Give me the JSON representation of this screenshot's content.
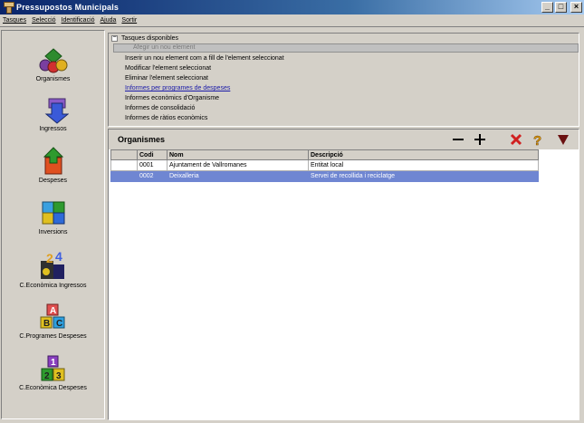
{
  "window": {
    "title": "Pressupostos Municipals"
  },
  "menu": [
    "Tasques",
    "Selecció",
    "Identificació",
    "Ajuda",
    "Sortir"
  ],
  "sidebar": {
    "items": [
      {
        "label": "Organismes",
        "icon": "organismes-icon"
      },
      {
        "label": "Ingressos",
        "icon": "ingressos-icon"
      },
      {
        "label": "Despeses",
        "icon": "despeses-icon"
      },
      {
        "label": "Inversions",
        "icon": "inversions-icon"
      },
      {
        "label": "C.Econòmica Ingressos",
        "icon": "c-economica-ingressos-icon"
      },
      {
        "label": "C.Programes Despeses",
        "icon": "c-programes-despeses-icon"
      },
      {
        "label": "C.Econòmica Despeses",
        "icon": "c-economica-despeses-icon"
      }
    ]
  },
  "tasks": {
    "header": "Tasques disponibles",
    "items": [
      "Afegir un nou element",
      "Inserir un nou element com a fill de l'element seleccionat",
      "Modificar l'element seleccionat",
      "Eliminar l'element seleccionat",
      "Informes per programes de despeses",
      "Informes econòmics d'Organisme",
      "Informes de consolidació",
      "Informes de ràtios econòmics"
    ]
  },
  "list": {
    "title": "Organismes",
    "columns": [
      "Codi",
      "Nom",
      "Descripció"
    ],
    "rows": [
      {
        "codi": "0001",
        "nom": "Ajuntament de Vallromanes",
        "descripcio": "Entitat local"
      },
      {
        "codi": "0002",
        "nom": "Deixalleria",
        "descripcio": "Servei de recollida i reciclatge"
      }
    ]
  },
  "colors": {
    "selection": "#6f86d2",
    "title_start": "#0a246a",
    "link": "#1a1aa8"
  }
}
